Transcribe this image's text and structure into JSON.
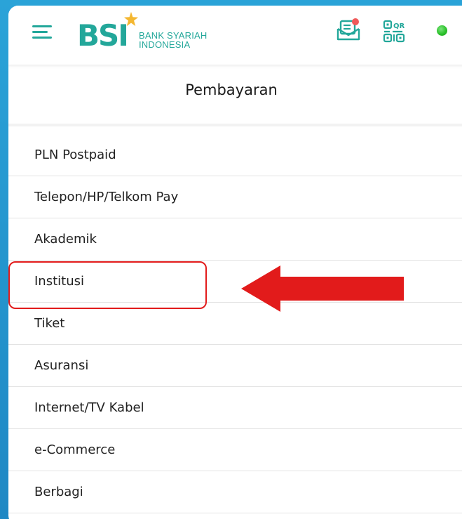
{
  "header": {
    "logo": {
      "mark": "BSI",
      "line1": "BANK SYARIAH",
      "line2": "INDONESIA"
    },
    "icons": [
      "menu-icon",
      "inbox-icon",
      "qr-code-icon",
      "status-dot"
    ],
    "qr_label": "QR"
  },
  "page": {
    "title": "Pembayaran"
  },
  "menu": {
    "items": [
      {
        "label": "PLN Postpaid"
      },
      {
        "label": "Telepon/HP/Telkom Pay"
      },
      {
        "label": "Akademik"
      },
      {
        "label": "Institusi"
      },
      {
        "label": "Tiket"
      },
      {
        "label": "Asuransi"
      },
      {
        "label": "Internet/TV Kabel"
      },
      {
        "label": "e-Commerce"
      },
      {
        "label": "Berbagi"
      }
    ]
  },
  "annotation": {
    "highlighted_item": "Institusi",
    "highlight_color": "#e21b1b"
  },
  "colors": {
    "brand": "#23a79a",
    "brand_star": "#f4b731",
    "background": "#1f88c4",
    "status": "#2cc22c",
    "notification": "#f05a5a"
  }
}
